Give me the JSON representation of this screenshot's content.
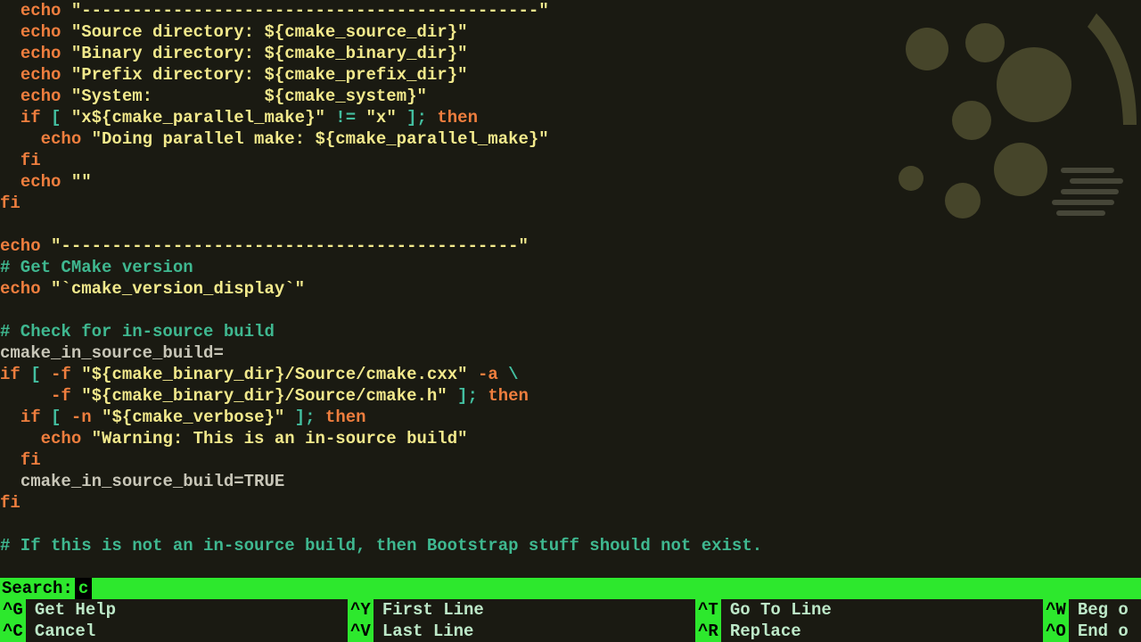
{
  "code": {
    "lines": [
      {
        "indent": 2,
        "tokens": [
          {
            "c": "kw",
            "t": "echo"
          },
          {
            "c": "plain",
            "t": " "
          },
          {
            "c": "str",
            "t": "\"---------------------------------------------\""
          }
        ]
      },
      {
        "indent": 2,
        "tokens": [
          {
            "c": "kw",
            "t": "echo"
          },
          {
            "c": "plain",
            "t": " "
          },
          {
            "c": "str",
            "t": "\"Source directory: ${cmake_source_dir}\""
          }
        ]
      },
      {
        "indent": 2,
        "tokens": [
          {
            "c": "kw",
            "t": "echo"
          },
          {
            "c": "plain",
            "t": " "
          },
          {
            "c": "str",
            "t": "\"Binary directory: ${cmake_binary_dir}\""
          }
        ]
      },
      {
        "indent": 2,
        "tokens": [
          {
            "c": "kw",
            "t": "echo"
          },
          {
            "c": "plain",
            "t": " "
          },
          {
            "c": "str",
            "t": "\"Prefix directory: ${cmake_prefix_dir}\""
          }
        ]
      },
      {
        "indent": 2,
        "tokens": [
          {
            "c": "kw",
            "t": "echo"
          },
          {
            "c": "plain",
            "t": " "
          },
          {
            "c": "str",
            "t": "\"System:           ${cmake_system}\""
          }
        ]
      },
      {
        "indent": 2,
        "tokens": [
          {
            "c": "kw",
            "t": "if"
          },
          {
            "c": "plain",
            "t": " "
          },
          {
            "c": "op",
            "t": "["
          },
          {
            "c": "plain",
            "t": " "
          },
          {
            "c": "str",
            "t": "\"x${cmake_parallel_make}\""
          },
          {
            "c": "plain",
            "t": " "
          },
          {
            "c": "op",
            "t": "!="
          },
          {
            "c": "plain",
            "t": " "
          },
          {
            "c": "str",
            "t": "\"x\""
          },
          {
            "c": "plain",
            "t": " "
          },
          {
            "c": "op",
            "t": "];"
          },
          {
            "c": "plain",
            "t": " "
          },
          {
            "c": "kw",
            "t": "then"
          }
        ]
      },
      {
        "indent": 4,
        "tokens": [
          {
            "c": "kw",
            "t": "echo"
          },
          {
            "c": "plain",
            "t": " "
          },
          {
            "c": "str",
            "t": "\"Doing parallel make: ${cmake_parallel_make}\""
          }
        ]
      },
      {
        "indent": 2,
        "tokens": [
          {
            "c": "kw",
            "t": "fi"
          }
        ]
      },
      {
        "indent": 2,
        "tokens": [
          {
            "c": "kw",
            "t": "echo"
          },
          {
            "c": "plain",
            "t": " "
          },
          {
            "c": "str",
            "t": "\"\""
          }
        ]
      },
      {
        "indent": 0,
        "tokens": [
          {
            "c": "kw",
            "t": "fi"
          }
        ]
      },
      {
        "indent": 0,
        "tokens": []
      },
      {
        "indent": 0,
        "tokens": [
          {
            "c": "kw",
            "t": "echo"
          },
          {
            "c": "plain",
            "t": " "
          },
          {
            "c": "str",
            "t": "\"---------------------------------------------\""
          }
        ]
      },
      {
        "indent": 0,
        "tokens": [
          {
            "c": "cmt",
            "t": "# Get CMake version"
          }
        ]
      },
      {
        "indent": 0,
        "tokens": [
          {
            "c": "kw",
            "t": "echo"
          },
          {
            "c": "plain",
            "t": " "
          },
          {
            "c": "str",
            "t": "\"`cmake_version_display`\""
          }
        ]
      },
      {
        "indent": 0,
        "tokens": []
      },
      {
        "indent": 0,
        "tokens": [
          {
            "c": "cmt",
            "t": "# Check for in-source build"
          }
        ]
      },
      {
        "indent": 0,
        "tokens": [
          {
            "c": "plain",
            "t": "cmake_in_source_build="
          }
        ]
      },
      {
        "indent": 0,
        "tokens": [
          {
            "c": "kw",
            "t": "if"
          },
          {
            "c": "plain",
            "t": " "
          },
          {
            "c": "op",
            "t": "["
          },
          {
            "c": "plain",
            "t": " "
          },
          {
            "c": "kw",
            "t": "-f"
          },
          {
            "c": "plain",
            "t": " "
          },
          {
            "c": "str",
            "t": "\"${cmake_binary_dir}/Source/cmake.cxx\""
          },
          {
            "c": "plain",
            "t": " "
          },
          {
            "c": "kw",
            "t": "-a"
          },
          {
            "c": "plain",
            "t": " "
          },
          {
            "c": "op",
            "t": "\\"
          }
        ]
      },
      {
        "indent": 5,
        "tokens": [
          {
            "c": "kw",
            "t": "-f"
          },
          {
            "c": "plain",
            "t": " "
          },
          {
            "c": "str",
            "t": "\"${cmake_binary_dir}/Source/cmake.h\""
          },
          {
            "c": "plain",
            "t": " "
          },
          {
            "c": "op",
            "t": "];"
          },
          {
            "c": "plain",
            "t": " "
          },
          {
            "c": "kw",
            "t": "then"
          }
        ]
      },
      {
        "indent": 2,
        "tokens": [
          {
            "c": "kw",
            "t": "if"
          },
          {
            "c": "plain",
            "t": " "
          },
          {
            "c": "op",
            "t": "["
          },
          {
            "c": "plain",
            "t": " "
          },
          {
            "c": "kw",
            "t": "-n"
          },
          {
            "c": "plain",
            "t": " "
          },
          {
            "c": "str",
            "t": "\"${cmake_verbose}\""
          },
          {
            "c": "plain",
            "t": " "
          },
          {
            "c": "op",
            "t": "];"
          },
          {
            "c": "plain",
            "t": " "
          },
          {
            "c": "kw",
            "t": "then"
          }
        ]
      },
      {
        "indent": 4,
        "tokens": [
          {
            "c": "kw",
            "t": "echo"
          },
          {
            "c": "plain",
            "t": " "
          },
          {
            "c": "str",
            "t": "\"Warning: This is an in-source build\""
          }
        ]
      },
      {
        "indent": 2,
        "tokens": [
          {
            "c": "kw",
            "t": "fi"
          }
        ]
      },
      {
        "indent": 2,
        "tokens": [
          {
            "c": "plain",
            "t": "cmake_in_source_build="
          },
          {
            "c": "plain",
            "t": "TRUE"
          }
        ]
      },
      {
        "indent": 0,
        "tokens": [
          {
            "c": "kw",
            "t": "fi"
          }
        ]
      },
      {
        "indent": 0,
        "tokens": []
      },
      {
        "indent": 0,
        "tokens": [
          {
            "c": "cmt",
            "t": "# If this is not an in-source build, then Bootstrap stuff should not exist."
          }
        ]
      }
    ]
  },
  "search": {
    "label": "Search:",
    "value": "c"
  },
  "help": [
    {
      "key": "^G",
      "label": "Get Help"
    },
    {
      "key": "^C",
      "label": "Cancel"
    },
    {
      "key": "^Y",
      "label": "First Line"
    },
    {
      "key": "^V",
      "label": "Last Line"
    },
    {
      "key": "^T",
      "label": "Go To Line"
    },
    {
      "key": "^R",
      "label": "Replace"
    },
    {
      "key": "^W",
      "label": "Beg o"
    },
    {
      "key": "^O",
      "label": "End o"
    }
  ]
}
